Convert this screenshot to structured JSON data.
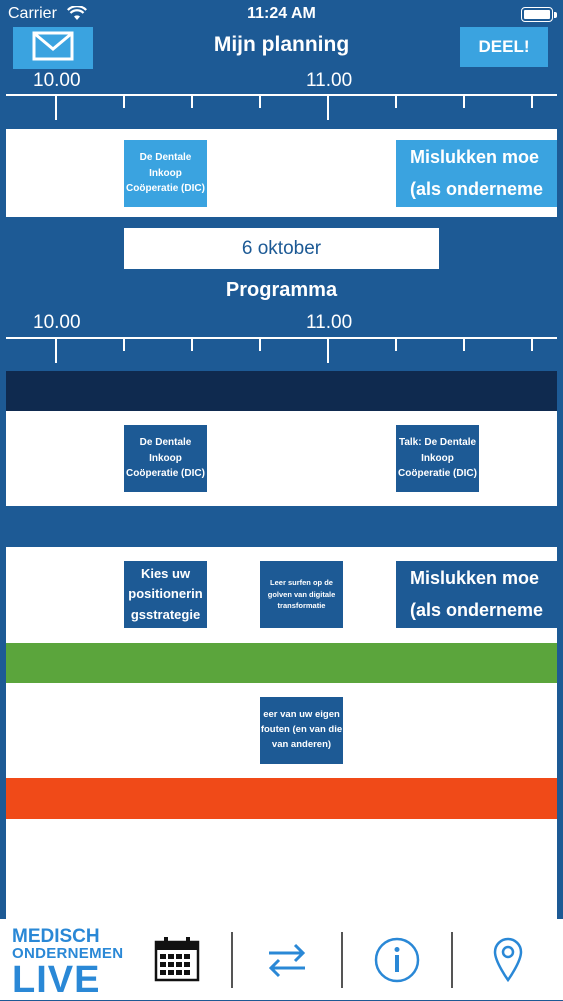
{
  "status_bar": {
    "carrier": "Carrier",
    "time": "11:24 AM"
  },
  "header": {
    "title": "Mijn planning",
    "share_label": "DEEL!"
  },
  "timeline": {
    "label_a": "10.00",
    "label_b": "11.00"
  },
  "my_planning": {
    "item1": "De Dentale Inkoop Coöperatie (DIC)",
    "item2_line1": "Mislukken moe",
    "item2_line2": "(als onderneme"
  },
  "date": "6 oktober",
  "section_title": "Programma",
  "program": {
    "row1_item1": "De Dentale Inkoop Coöperatie (DIC)",
    "row1_item2": "Talk: De Dentale Inkoop Coöperatie (DIC)",
    "row2_item1_line1": "Kies uw",
    "row2_item1_line2": "positionerin",
    "row2_item1_line3": "gsstrategie",
    "row2_item2": "Leer surfen op de golven van digitale transformatie",
    "row2_item3_line1": "Mislukken moe",
    "row2_item3_line2": "(als onderneme",
    "row3_item1": "eer van uw eigen fouten (en van die van anderen)"
  },
  "logo": {
    "line1": "MEDISCH",
    "line2": "ONDERNEMEN",
    "line3": "LIVE"
  },
  "tabs": [
    "calendar-icon",
    "swap-arrows-icon",
    "info-icon",
    "location-pin-icon"
  ],
  "colors": {
    "background": "#1d5a95",
    "accent": "#3aa3e0",
    "navy": "#0f2a4f",
    "green": "#5ba53c",
    "orange": "#f04a18"
  }
}
